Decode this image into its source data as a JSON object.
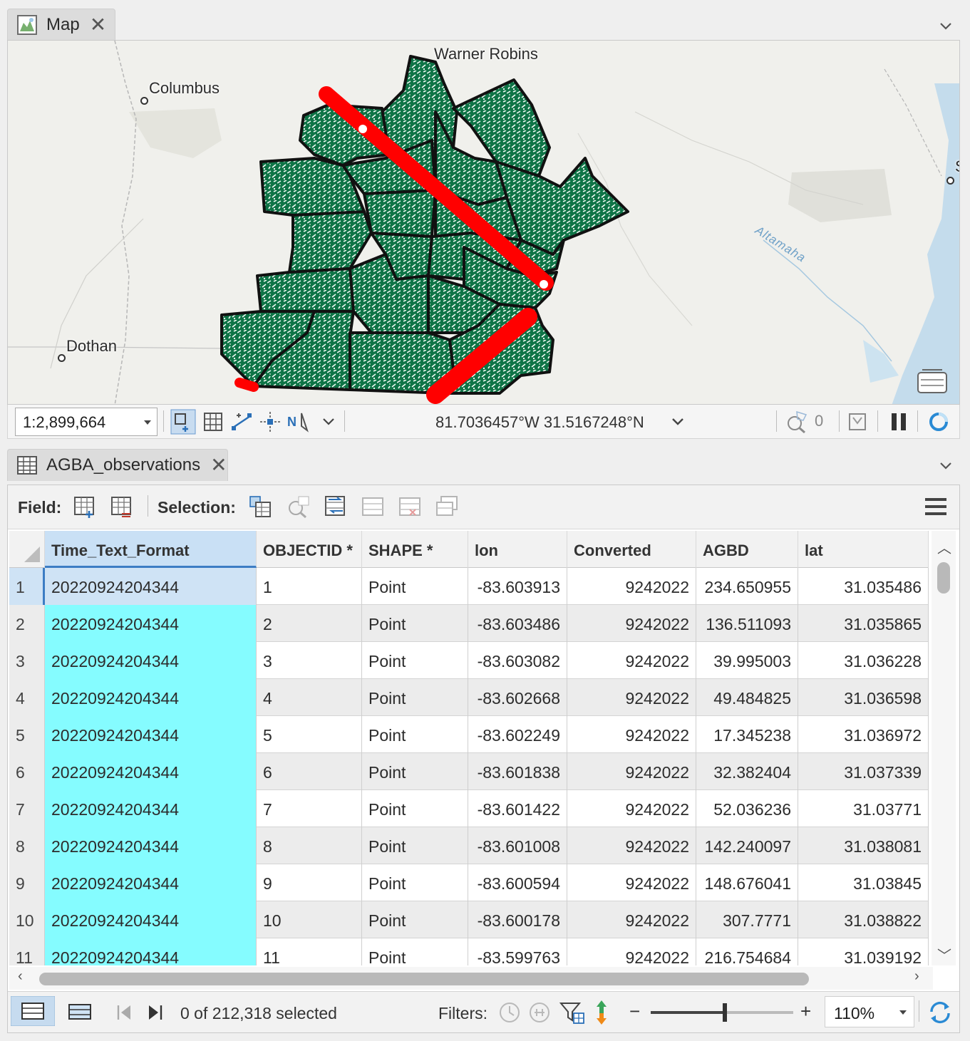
{
  "map_tab": {
    "label": "Map",
    "close": "✕"
  },
  "map": {
    "labels": {
      "warner_robins": "Warner Robins",
      "columbus": "Columbus",
      "dothan": "Dothan",
      "river": "Altamaha",
      "edge_s": "S"
    },
    "status": {
      "scale": "1:2,899,664",
      "coordinates": "81.7036457°W 31.5167248°N",
      "selected_count": "0"
    }
  },
  "table_tab": {
    "label": "AGBA_observations",
    "close": "✕"
  },
  "toolbar": {
    "field_label": "Field:",
    "selection_label": "Selection:"
  },
  "table": {
    "columns": [
      "Time_Text_Format",
      "OBJECTID *",
      "SHAPE *",
      "lon",
      "Converted",
      "AGBD",
      "lat"
    ],
    "rows": [
      {
        "n": "1",
        "time": "20220924204344",
        "oid": "1",
        "shape": "Point",
        "lon": "-83.603913",
        "conv": "9242022",
        "agbd": "234.650955",
        "lat": "31.035486"
      },
      {
        "n": "2",
        "time": "20220924204344",
        "oid": "2",
        "shape": "Point",
        "lon": "-83.603486",
        "conv": "9242022",
        "agbd": "136.511093",
        "lat": "31.035865"
      },
      {
        "n": "3",
        "time": "20220924204344",
        "oid": "3",
        "shape": "Point",
        "lon": "-83.603082",
        "conv": "9242022",
        "agbd": "39.995003",
        "lat": "31.036228"
      },
      {
        "n": "4",
        "time": "20220924204344",
        "oid": "4",
        "shape": "Point",
        "lon": "-83.602668",
        "conv": "9242022",
        "agbd": "49.484825",
        "lat": "31.036598"
      },
      {
        "n": "5",
        "time": "20220924204344",
        "oid": "5",
        "shape": "Point",
        "lon": "-83.602249",
        "conv": "9242022",
        "agbd": "17.345238",
        "lat": "31.036972"
      },
      {
        "n": "6",
        "time": "20220924204344",
        "oid": "6",
        "shape": "Point",
        "lon": "-83.601838",
        "conv": "9242022",
        "agbd": "32.382404",
        "lat": "31.037339"
      },
      {
        "n": "7",
        "time": "20220924204344",
        "oid": "7",
        "shape": "Point",
        "lon": "-83.601422",
        "conv": "9242022",
        "agbd": "52.036236",
        "lat": "31.03771"
      },
      {
        "n": "8",
        "time": "20220924204344",
        "oid": "8",
        "shape": "Point",
        "lon": "-83.601008",
        "conv": "9242022",
        "agbd": "142.240097",
        "lat": "31.038081"
      },
      {
        "n": "9",
        "time": "20220924204344",
        "oid": "9",
        "shape": "Point",
        "lon": "-83.600594",
        "conv": "9242022",
        "agbd": "148.676041",
        "lat": "31.03845"
      },
      {
        "n": "10",
        "time": "20220924204344",
        "oid": "10",
        "shape": "Point",
        "lon": "-83.600178",
        "conv": "9242022",
        "agbd": "307.7771",
        "lat": "31.038822"
      },
      {
        "n": "11",
        "time": "20220924204344",
        "oid": "11",
        "shape": "Point",
        "lon": "-83.599763",
        "conv": "9242022",
        "agbd": "216.754684",
        "lat": "31.039192"
      }
    ]
  },
  "footer": {
    "selection_status": "0 of 212,318 selected",
    "filters_label": "Filters:",
    "zoom_minus": "−",
    "zoom_plus": "+",
    "zoom_value": "110%",
    "zoom_level": 0.52
  },
  "colors": {
    "accent": "#3c7dc4",
    "highlight_cell": "#85fcff",
    "forest": "#0e7446",
    "observation_track": "#ff0000"
  }
}
